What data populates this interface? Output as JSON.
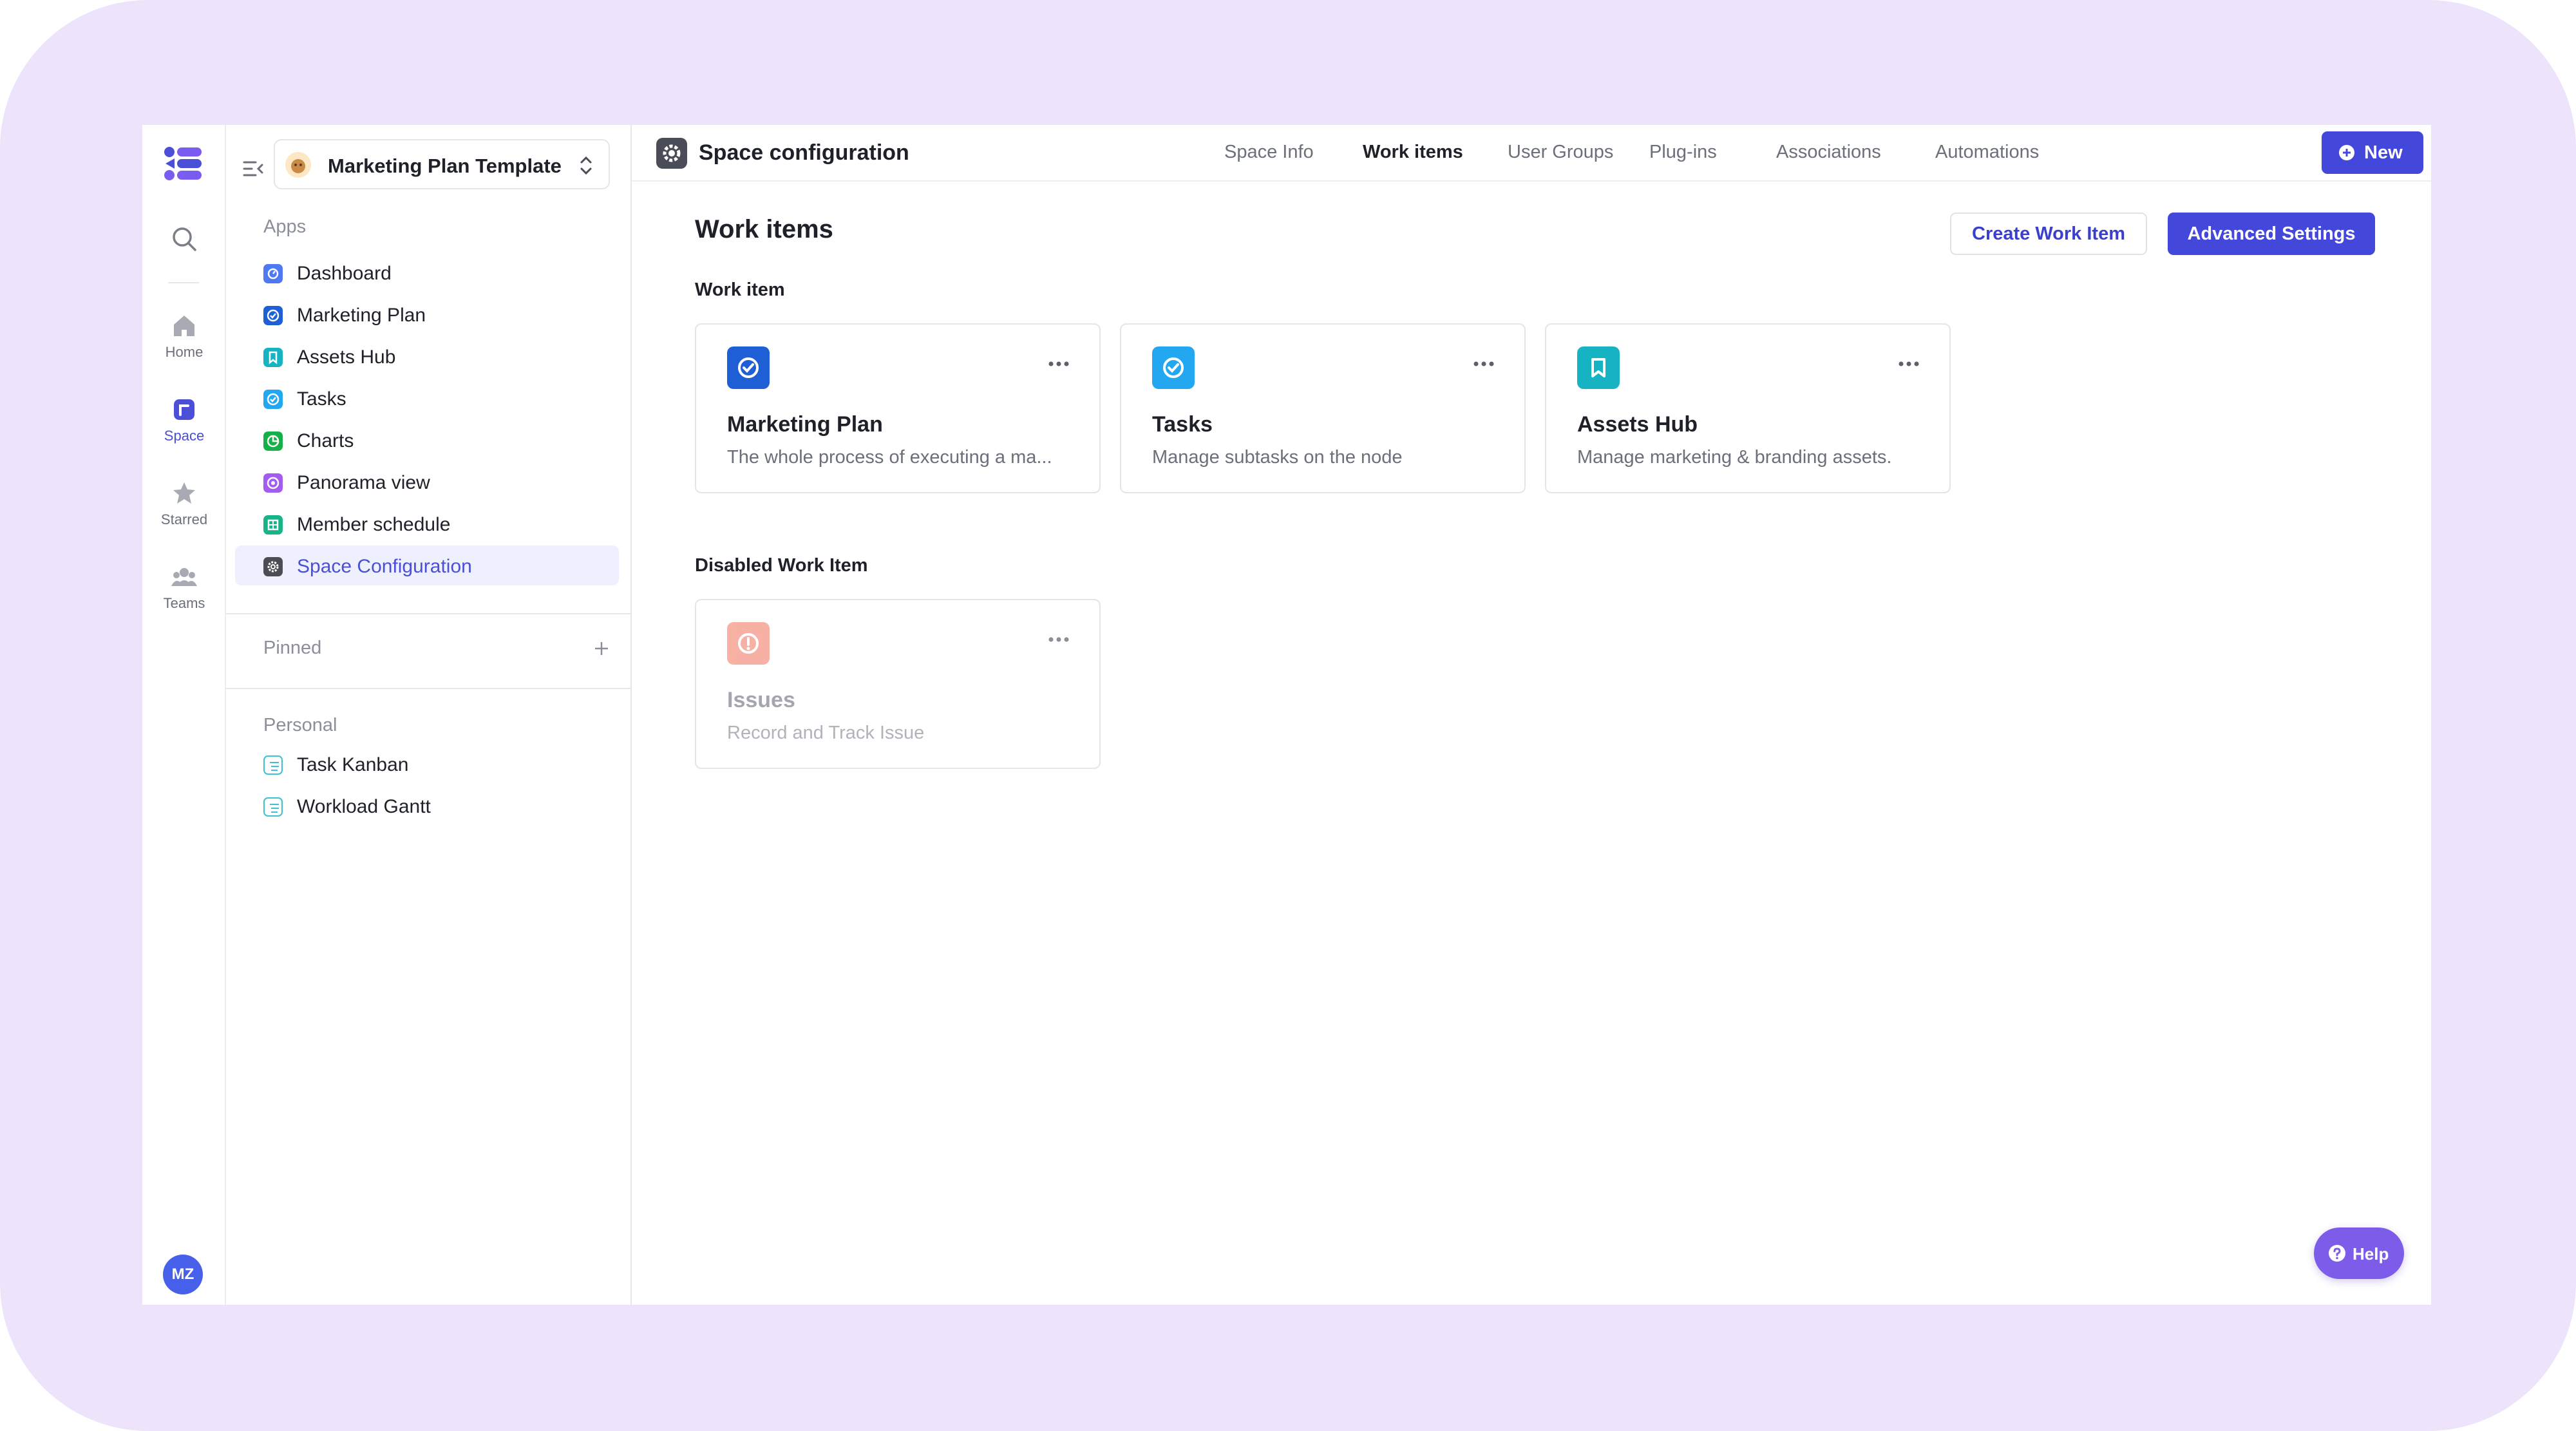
{
  "rail": {
    "items": [
      {
        "label": "Home",
        "icon": "home-icon"
      },
      {
        "label": "Space",
        "icon": "space-icon"
      },
      {
        "label": "Starred",
        "icon": "star-icon"
      },
      {
        "label": "Teams",
        "icon": "teams-icon"
      }
    ],
    "avatar": "MZ"
  },
  "sidebar": {
    "space_name": "Marketing Plan Template",
    "apps_title": "Apps",
    "apps": [
      {
        "label": "Dashboard",
        "color": "#4f79f2"
      },
      {
        "label": "Marketing Plan",
        "color": "#1e5fd6"
      },
      {
        "label": "Assets Hub",
        "color": "#16b3c3"
      },
      {
        "label": "Tasks",
        "color": "#22a7f0"
      },
      {
        "label": "Charts",
        "color": "#16b049"
      },
      {
        "label": "Panorama view",
        "color": "#a45cf0"
      },
      {
        "label": "Member schedule",
        "color": "#18b388"
      },
      {
        "label": "Space Configuration",
        "color": "#4b4d55"
      }
    ],
    "pinned_title": "Pinned",
    "personal_title": "Personal",
    "personal": [
      {
        "label": "Task Kanban"
      },
      {
        "label": "Workload Gantt"
      }
    ]
  },
  "header": {
    "title": "Space configuration",
    "tabs": [
      {
        "label": "Space Info"
      },
      {
        "label": "Work items"
      },
      {
        "label": "User Groups"
      },
      {
        "label": "Plug-ins"
      },
      {
        "label": "Associations"
      },
      {
        "label": "Automations"
      }
    ],
    "new_label": "New"
  },
  "main": {
    "title": "Work items",
    "create_label": "Create Work Item",
    "advanced_label": "Advanced Settings",
    "work_item_title": "Work item",
    "cards": [
      {
        "title": "Marketing Plan",
        "desc": "The whole process of executing a ma...",
        "color": "#1e5fd6"
      },
      {
        "title": "Tasks",
        "desc": "Manage subtasks on the node",
        "color": "#22a7f0"
      },
      {
        "title": "Assets Hub",
        "desc": "Manage marketing & branding assets.",
        "color": "#16b3c3"
      }
    ],
    "disabled_title": "Disabled Work Item",
    "disabled_cards": [
      {
        "title": "Issues",
        "desc": "Record and Track Issue",
        "color": "#f2725a"
      }
    ]
  },
  "help_label": "Help"
}
